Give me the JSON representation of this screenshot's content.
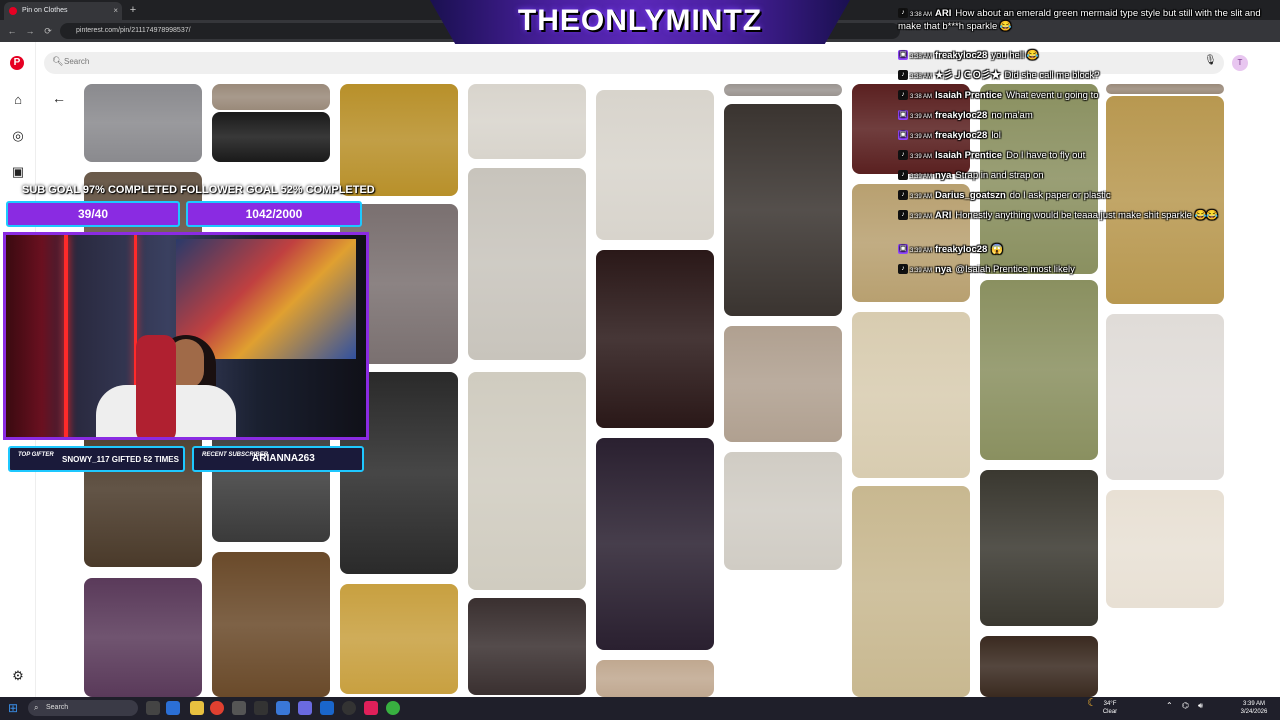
{
  "browser": {
    "tab_title": "Pin on Clothes",
    "tab_close": "×",
    "new_tab": "+",
    "url": "pinterest.com/pin/211174978998537/",
    "back": "←",
    "forward": "→",
    "reload": "⟳"
  },
  "pinterest": {
    "logo": "P",
    "search_placeholder": "Search",
    "avatar_initial": "T",
    "back_arrow": "←",
    "pins": [
      {
        "col": 0,
        "tone": "#8a8a8e"
      },
      {
        "col": 0,
        "tone": "#6a5a4a"
      },
      {
        "col": 0,
        "tone": "#4a3a2a"
      },
      {
        "col": 0,
        "tone": "#5a3a5a"
      },
      {
        "col": 1,
        "tone": "#9a8a7a"
      },
      {
        "col": 1,
        "tone": "#1a1a1a"
      },
      {
        "col": 1,
        "tone": "#3a3a3a"
      },
      {
        "col": 1,
        "tone": "#6a4a2a"
      },
      {
        "col": 2,
        "tone": "#b8902a"
      },
      {
        "col": 2,
        "tone": "#7a7070"
      },
      {
        "col": 2,
        "tone": "#2a2a2a"
      },
      {
        "col": 2,
        "tone": "#c8a040"
      },
      {
        "col": 3,
        "tone": "#d8d4cc"
      },
      {
        "col": 3,
        "tone": "#c8c4bc"
      },
      {
        "col": 3,
        "tone": "#d0ccc0"
      },
      {
        "col": 3,
        "tone": "#3a3030"
      },
      {
        "col": 4,
        "tone": "#d8d4cc"
      },
      {
        "col": 4,
        "tone": "#2a1818"
      },
      {
        "col": 4,
        "tone": "#2a2030"
      },
      {
        "col": 4,
        "tone": "#c0a890"
      },
      {
        "col": 5,
        "tone": "#9a9490"
      },
      {
        "col": 5,
        "tone": "#3a3430"
      },
      {
        "col": 5,
        "tone": "#b0a090"
      },
      {
        "col": 5,
        "tone": "#d0ccc4"
      },
      {
        "col": 6,
        "tone": "#5a2020"
      },
      {
        "col": 6,
        "tone": "#b8a070"
      },
      {
        "col": 6,
        "tone": "#d8ccb0"
      },
      {
        "col": 6,
        "tone": "#c8b890"
      },
      {
        "col": 7,
        "tone": "#8a9060"
      },
      {
        "col": 7,
        "tone": "#8a9060"
      },
      {
        "col": 7,
        "tone": "#3a3830"
      },
      {
        "col": 7,
        "tone": "#3a2a20"
      },
      {
        "col": 8,
        "tone": "#9a8a7a"
      },
      {
        "col": 8,
        "tone": "#b89850"
      },
      {
        "col": 8,
        "tone": "#e0dcd8"
      },
      {
        "col": 8,
        "tone": "#e8e0d4"
      }
    ]
  },
  "stream": {
    "title": "THEONLYMINTZ",
    "sub_goal_label": "SUB GOAL 97% COMPLETED",
    "follower_goal_label": "FOLLOWER GOAL 52% COMPLETED",
    "sub_goal_value": "39/40",
    "follower_goal_value": "1042/2000",
    "top_gifter_label": "TOP GIFTER",
    "top_gifter_value": "SNOWY_117 GIFTED 52 TIMES",
    "recent_sub_label": "RECENT SUBSCRIBER",
    "recent_sub_value": "ARIANNA263"
  },
  "chat": [
    {
      "platform": "tt",
      "time": "3:38 AM",
      "user": "ARI",
      "msg": "How about an emerald green mermaid type style but still with the slit and make that b***h sparkle 😂",
      "color": "#ffffff"
    },
    {
      "platform": "tw",
      "time": "3:38 AM",
      "user": "freakyloc28",
      "msg": "you hell 😂",
      "color": "#ffffff"
    },
    {
      "platform": "tt",
      "time": "3:38 AM",
      "user": "★彡ＪＣＯ彡★",
      "msg": "Did she call me block?",
      "color": "#ffffff"
    },
    {
      "platform": "tt",
      "time": "3:38 AM",
      "user": "Isaiah Prentice",
      "msg": "What event u going to",
      "color": "#ffffff"
    },
    {
      "platform": "tw",
      "time": "3:39 AM",
      "user": "freakyloc28",
      "msg": "no ma'am",
      "color": "#ffffff"
    },
    {
      "platform": "tw",
      "time": "3:39 AM",
      "user": "freakyloc28",
      "msg": "lol",
      "color": "#ffffff"
    },
    {
      "platform": "tt",
      "time": "3:39 AM",
      "user": "Isaiah Prentice",
      "msg": "Do I have to fly out",
      "color": "#ffffff"
    },
    {
      "platform": "tt",
      "time": "3:39 AM",
      "user": "nya",
      "msg": "Strap in and strap on",
      "color": "#ffffff"
    },
    {
      "platform": "tt",
      "time": "3:39 AM",
      "user": "Darius_goatszn",
      "msg": "do I ask paper or plastic",
      "color": "#ffffff"
    },
    {
      "platform": "tt",
      "time": "3:39 AM",
      "user": "ARI",
      "msg": "Honestly anything would be teaaa just make shit sparkle 😂😂",
      "color": "#ffffff"
    },
    {
      "platform": "tw",
      "time": "3:39 AM",
      "user": "freakyloc28",
      "msg": "😱",
      "color": "#ffffff"
    },
    {
      "platform": "tt",
      "time": "3:39 AM",
      "user": "nya",
      "msg": "@Isaiah Prentice most likely",
      "color": "#ffffff"
    }
  ],
  "taskbar": {
    "search": "Search",
    "weather_temp": "34°F",
    "weather_desc": "Clear",
    "clock_time": "3:39 AM",
    "clock_date": "3/24/2026"
  }
}
